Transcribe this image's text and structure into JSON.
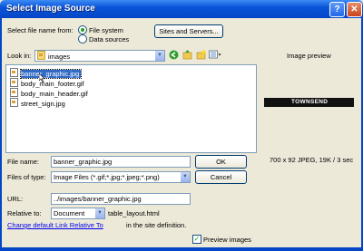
{
  "window": {
    "title": "Select Image Source",
    "help_glyph": "?",
    "close_glyph": "✕"
  },
  "source": {
    "label": "Select file name from:",
    "option_file_system": "File system",
    "option_data_sources": "Data sources",
    "sites_button": "Sites and Servers..."
  },
  "lookin": {
    "label": "Look in:",
    "value": "images"
  },
  "files": [
    "banner_graphic.jpg",
    "body_main_footer.gif",
    "body_main_header.gif",
    "street_sign.jpg"
  ],
  "preview": {
    "title": "Image preview",
    "banner_text": "TOWNSEND",
    "info": "700 x 92 JPEG, 19K / 3 sec"
  },
  "filename": {
    "label": "File name:",
    "value": "banner_graphic.jpg",
    "ok": "OK"
  },
  "filetype": {
    "label": "Files of type:",
    "value": "Image Files (*.gif;*.jpg;*.jpeg;*.png)",
    "cancel": "Cancel"
  },
  "url": {
    "label": "URL:",
    "value": "../images/banner_graphic.jpg"
  },
  "relative": {
    "label": "Relative to:",
    "value": "Document",
    "file": "table_layout.html"
  },
  "change_link": {
    "link_text": "Change default Link Relative To",
    "suffix": "in the site definition."
  },
  "preview_images": {
    "label": "Preview images",
    "checked": true
  }
}
